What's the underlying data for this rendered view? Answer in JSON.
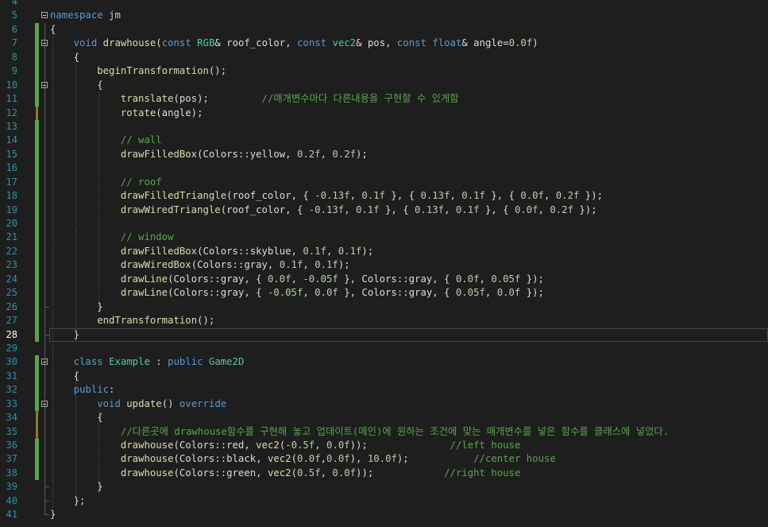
{
  "editor": {
    "current_line": 28,
    "lines": [
      {
        "n": 4,
        "tokens": []
      },
      {
        "n": 5,
        "fold": "open",
        "tokens": [
          {
            "t": "namespace",
            "c": "k"
          },
          {
            "t": " jm",
            "c": "ns"
          }
        ]
      },
      {
        "n": 6,
        "tokens": [
          {
            "t": "{",
            "c": "w"
          }
        ]
      },
      {
        "n": 7,
        "fold": "open",
        "tokens": [
          {
            "t": "    "
          },
          {
            "t": "void",
            "c": "k"
          },
          {
            "t": " "
          },
          {
            "t": "drawhouse",
            "c": "f"
          },
          {
            "t": "(",
            "c": "w"
          },
          {
            "t": "const",
            "c": "k"
          },
          {
            "t": " "
          },
          {
            "t": "RGB",
            "c": "t"
          },
          {
            "t": "& roof_color, ",
            "c": "w"
          },
          {
            "t": "const",
            "c": "k"
          },
          {
            "t": " "
          },
          {
            "t": "vec2",
            "c": "t"
          },
          {
            "t": "& pos, ",
            "c": "w"
          },
          {
            "t": "const",
            "c": "k"
          },
          {
            "t": " "
          },
          {
            "t": "float",
            "c": "k"
          },
          {
            "t": "& angle=",
            "c": "w"
          },
          {
            "t": "0.0f",
            "c": "n"
          },
          {
            "t": ")",
            "c": "w"
          }
        ]
      },
      {
        "n": 8,
        "tokens": [
          {
            "t": "    {",
            "c": "w"
          }
        ]
      },
      {
        "n": 9,
        "tokens": [
          {
            "t": "        "
          },
          {
            "t": "beginTransformation",
            "c": "f"
          },
          {
            "t": "();",
            "c": "w"
          }
        ]
      },
      {
        "n": 10,
        "fold": "open",
        "tokens": [
          {
            "t": "        {",
            "c": "w"
          }
        ]
      },
      {
        "n": 11,
        "tokens": [
          {
            "t": "            "
          },
          {
            "t": "translate",
            "c": "f"
          },
          {
            "t": "(pos);",
            "c": "w"
          },
          {
            "t": "         "
          },
          {
            "t": "//매개변수마다 다른내용을 구현할 수 있게함",
            "c": "c"
          }
        ]
      },
      {
        "n": 12,
        "tokens": [
          {
            "t": "            "
          },
          {
            "t": "rotate",
            "c": "f"
          },
          {
            "t": "(angle);",
            "c": "w"
          }
        ]
      },
      {
        "n": 13,
        "tokens": []
      },
      {
        "n": 14,
        "tokens": [
          {
            "t": "            "
          },
          {
            "t": "// wall",
            "c": "c"
          }
        ]
      },
      {
        "n": 15,
        "tokens": [
          {
            "t": "            "
          },
          {
            "t": "drawFilledBox",
            "c": "f"
          },
          {
            "t": "(Colors::",
            "c": "w"
          },
          {
            "t": "yellow",
            "c": "w"
          },
          {
            "t": ", ",
            "c": "w"
          },
          {
            "t": "0.2f",
            "c": "n"
          },
          {
            "t": ", ",
            "c": "w"
          },
          {
            "t": "0.2f",
            "c": "n"
          },
          {
            "t": ");",
            "c": "w"
          }
        ]
      },
      {
        "n": 16,
        "tokens": []
      },
      {
        "n": 17,
        "tokens": [
          {
            "t": "            "
          },
          {
            "t": "// roof",
            "c": "c"
          }
        ]
      },
      {
        "n": 18,
        "tokens": [
          {
            "t": "            "
          },
          {
            "t": "drawFilledTriangle",
            "c": "f"
          },
          {
            "t": "(roof_color, { ",
            "c": "w"
          },
          {
            "t": "-0.13f",
            "c": "n"
          },
          {
            "t": ", ",
            "c": "w"
          },
          {
            "t": "0.1f",
            "c": "n"
          },
          {
            "t": " }, { ",
            "c": "w"
          },
          {
            "t": "0.13f",
            "c": "n"
          },
          {
            "t": ", ",
            "c": "w"
          },
          {
            "t": "0.1f",
            "c": "n"
          },
          {
            "t": " }, { ",
            "c": "w"
          },
          {
            "t": "0.0f",
            "c": "n"
          },
          {
            "t": ", ",
            "c": "w"
          },
          {
            "t": "0.2f",
            "c": "n"
          },
          {
            "t": " });",
            "c": "w"
          }
        ]
      },
      {
        "n": 19,
        "tokens": [
          {
            "t": "            "
          },
          {
            "t": "drawWiredTriangle",
            "c": "f"
          },
          {
            "t": "(roof_color, { ",
            "c": "w"
          },
          {
            "t": "-0.13f",
            "c": "n"
          },
          {
            "t": ", ",
            "c": "w"
          },
          {
            "t": "0.1f",
            "c": "n"
          },
          {
            "t": " }, { ",
            "c": "w"
          },
          {
            "t": "0.13f",
            "c": "n"
          },
          {
            "t": ", ",
            "c": "w"
          },
          {
            "t": "0.1f",
            "c": "n"
          },
          {
            "t": " }, { ",
            "c": "w"
          },
          {
            "t": "0.0f",
            "c": "n"
          },
          {
            "t": ", ",
            "c": "w"
          },
          {
            "t": "0.2f",
            "c": "n"
          },
          {
            "t": " });",
            "c": "w"
          }
        ]
      },
      {
        "n": 20,
        "tokens": []
      },
      {
        "n": 21,
        "tokens": [
          {
            "t": "            "
          },
          {
            "t": "// window",
            "c": "c"
          }
        ]
      },
      {
        "n": 22,
        "tokens": [
          {
            "t": "            "
          },
          {
            "t": "drawFilledBox",
            "c": "f"
          },
          {
            "t": "(Colors::skyblue, ",
            "c": "w"
          },
          {
            "t": "0.1f",
            "c": "n"
          },
          {
            "t": ", ",
            "c": "w"
          },
          {
            "t": "0.1f",
            "c": "n"
          },
          {
            "t": ");",
            "c": "w"
          }
        ]
      },
      {
        "n": 23,
        "tokens": [
          {
            "t": "            "
          },
          {
            "t": "drawWiredBox",
            "c": "f"
          },
          {
            "t": "(Colors::gray, ",
            "c": "w"
          },
          {
            "t": "0.1f",
            "c": "n"
          },
          {
            "t": ", ",
            "c": "w"
          },
          {
            "t": "0.1f",
            "c": "n"
          },
          {
            "t": ");",
            "c": "w"
          }
        ]
      },
      {
        "n": 24,
        "tokens": [
          {
            "t": "            "
          },
          {
            "t": "drawLine",
            "c": "f"
          },
          {
            "t": "(Colors::gray, { ",
            "c": "w"
          },
          {
            "t": "0.0f",
            "c": "n"
          },
          {
            "t": ", ",
            "c": "w"
          },
          {
            "t": "-0.05f",
            "c": "n"
          },
          {
            "t": " }, Colors::gray, { ",
            "c": "w"
          },
          {
            "t": "0.0f",
            "c": "n"
          },
          {
            "t": ", ",
            "c": "w"
          },
          {
            "t": "0.05f",
            "c": "n"
          },
          {
            "t": " });",
            "c": "w"
          }
        ]
      },
      {
        "n": 25,
        "tokens": [
          {
            "t": "            "
          },
          {
            "t": "drawLine",
            "c": "f"
          },
          {
            "t": "(Colors::gray, { ",
            "c": "w"
          },
          {
            "t": "-0.05f",
            "c": "n"
          },
          {
            "t": ", ",
            "c": "w"
          },
          {
            "t": "0.0f",
            "c": "n"
          },
          {
            "t": " }, Colors::gray, { ",
            "c": "w"
          },
          {
            "t": "0.05f",
            "c": "n"
          },
          {
            "t": ", ",
            "c": "w"
          },
          {
            "t": "0.0f",
            "c": "n"
          },
          {
            "t": " });",
            "c": "w"
          }
        ]
      },
      {
        "n": 26,
        "tokens": [
          {
            "t": "        }",
            "c": "w"
          }
        ]
      },
      {
        "n": 27,
        "tokens": [
          {
            "t": "        "
          },
          {
            "t": "endTransformation",
            "c": "f"
          },
          {
            "t": "();",
            "c": "w"
          }
        ]
      },
      {
        "n": 28,
        "tokens": [
          {
            "t": "    }",
            "c": "w"
          }
        ]
      },
      {
        "n": 29,
        "tokens": []
      },
      {
        "n": 30,
        "fold": "open",
        "tokens": [
          {
            "t": "    "
          },
          {
            "t": "class",
            "c": "k"
          },
          {
            "t": " "
          },
          {
            "t": "Example",
            "c": "t"
          },
          {
            "t": " : ",
            "c": "w"
          },
          {
            "t": "public",
            "c": "k"
          },
          {
            "t": " "
          },
          {
            "t": "Game2D",
            "c": "t"
          }
        ]
      },
      {
        "n": 31,
        "tokens": [
          {
            "t": "    {",
            "c": "w"
          }
        ]
      },
      {
        "n": 32,
        "tokens": [
          {
            "t": "    "
          },
          {
            "t": "public",
            "c": "k"
          },
          {
            "t": ":",
            "c": "w"
          }
        ]
      },
      {
        "n": 33,
        "fold": "open",
        "tokens": [
          {
            "t": "        "
          },
          {
            "t": "void",
            "c": "k"
          },
          {
            "t": " "
          },
          {
            "t": "update",
            "c": "f"
          },
          {
            "t": "() ",
            "c": "w"
          },
          {
            "t": "override",
            "c": "k"
          }
        ]
      },
      {
        "n": 34,
        "tokens": [
          {
            "t": "        {",
            "c": "w"
          }
        ]
      },
      {
        "n": 35,
        "tokens": [
          {
            "t": "            "
          },
          {
            "t": "//다른곳에 drawhouse함수를 구현해 놓고 업데이트(메인)에 원하는 조건에 맞는 매개변수를 넣은 함수를 클래스에 넣었다.",
            "c": "c"
          }
        ]
      },
      {
        "n": 36,
        "tokens": [
          {
            "t": "            "
          },
          {
            "t": "drawhouse",
            "c": "f"
          },
          {
            "t": "(Colors::red, ",
            "c": "w"
          },
          {
            "t": "vec2",
            "c": "f"
          },
          {
            "t": "(",
            "c": "w"
          },
          {
            "t": "-0.5f",
            "c": "n"
          },
          {
            "t": ", ",
            "c": "w"
          },
          {
            "t": "0.0f",
            "c": "n"
          },
          {
            "t": "));",
            "c": "w"
          },
          {
            "t": "              "
          },
          {
            "t": "//left house",
            "c": "c"
          }
        ]
      },
      {
        "n": 37,
        "tokens": [
          {
            "t": "            "
          },
          {
            "t": "drawhouse",
            "c": "f"
          },
          {
            "t": "(Colors::black, ",
            "c": "w"
          },
          {
            "t": "vec2",
            "c": "f"
          },
          {
            "t": "(",
            "c": "w"
          },
          {
            "t": "0.0f",
            "c": "n"
          },
          {
            "t": ",",
            "c": "w"
          },
          {
            "t": "0.0f",
            "c": "n"
          },
          {
            "t": "), ",
            "c": "w"
          },
          {
            "t": "10.0f",
            "c": "n"
          },
          {
            "t": ");",
            "c": "w"
          },
          {
            "t": "           "
          },
          {
            "t": "//center house",
            "c": "c"
          }
        ]
      },
      {
        "n": 38,
        "tokens": [
          {
            "t": "            "
          },
          {
            "t": "drawhouse",
            "c": "f"
          },
          {
            "t": "(Colors::green, ",
            "c": "w"
          },
          {
            "t": "vec2",
            "c": "f"
          },
          {
            "t": "(",
            "c": "w"
          },
          {
            "t": "0.5f",
            "c": "n"
          },
          {
            "t": ", ",
            "c": "w"
          },
          {
            "t": "0.0f",
            "c": "n"
          },
          {
            "t": "));",
            "c": "w"
          },
          {
            "t": "            "
          },
          {
            "t": "//right house",
            "c": "c"
          }
        ]
      },
      {
        "n": 39,
        "tokens": [
          {
            "t": "        }",
            "c": "w"
          }
        ]
      },
      {
        "n": 40,
        "tokens": [
          {
            "t": "    };",
            "c": "w"
          }
        ]
      },
      {
        "n": 41,
        "tokens": [
          {
            "t": "}",
            "c": "w"
          }
        ]
      }
    ]
  },
  "colors": {
    "background": "#1e1e1e",
    "keyword": "#569cd6",
    "type": "#4ec9b0",
    "function": "#dcdcaa",
    "comment": "#57a64a",
    "number": "#b5cea8",
    "line_number": "#2b91af",
    "change_saved": "#57a64a",
    "change_unsaved": "#8f7a2a"
  }
}
